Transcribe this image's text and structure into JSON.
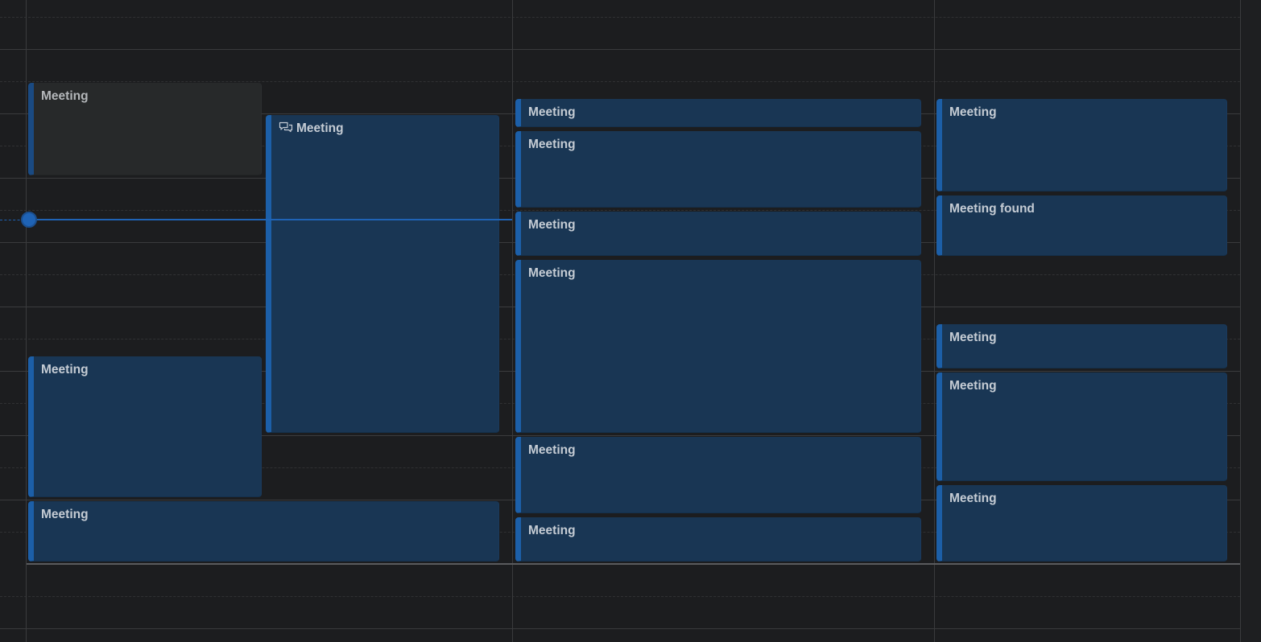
{
  "calendar": {
    "events": [
      {
        "id": "e1",
        "title": "Meeting",
        "status": "past"
      },
      {
        "id": "e2",
        "title": "Meeting",
        "icon": "chat-icon"
      },
      {
        "id": "e3",
        "title": "Meeting"
      },
      {
        "id": "e4",
        "title": "Meeting"
      },
      {
        "id": "e5",
        "title": "Meeting"
      },
      {
        "id": "e6",
        "title": "Meeting"
      },
      {
        "id": "e7",
        "title": "Meeting"
      },
      {
        "id": "e8",
        "title": "Meeting"
      },
      {
        "id": "e9",
        "title": "Meeting"
      },
      {
        "id": "e10",
        "title": "Meeting"
      },
      {
        "id": "e11",
        "title": "Meeting"
      },
      {
        "id": "e12",
        "title": "Meeting found"
      },
      {
        "id": "e13",
        "title": "Meeting"
      },
      {
        "id": "e14",
        "title": "Meeting"
      },
      {
        "id": "e15",
        "title": "Meeting"
      }
    ],
    "colors": {
      "background": "#1c1d1f",
      "event_fill": "#193654",
      "event_accent": "#1c5fa8",
      "past_event_fill": "#27292a",
      "now_indicator": "#1f63b5"
    }
  }
}
